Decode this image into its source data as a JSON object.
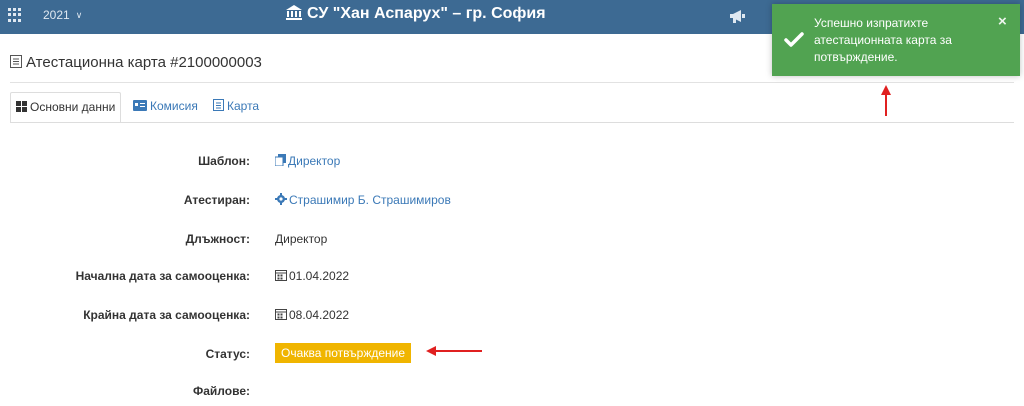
{
  "header": {
    "year": "2021",
    "school_name": "СУ \"Хан Аспарух\" – гр. София"
  },
  "page": {
    "title": "Атестационна карта #2100000003"
  },
  "tabs": [
    {
      "label": "Основни данни",
      "active": true
    },
    {
      "label": "Комисия",
      "active": false
    },
    {
      "label": "Карта",
      "active": false
    }
  ],
  "fields": {
    "template": {
      "label": "Шаблон:",
      "value": "Директор"
    },
    "attested": {
      "label": "Атестиран:",
      "value": "Страшимир Б. Страшимиров"
    },
    "position": {
      "label": "Длъжност:",
      "value": "Директор"
    },
    "start_date": {
      "label": "Начална дата за самооценка:",
      "value": "01.04.2022"
    },
    "end_date": {
      "label": "Крайна дата за самооценка:",
      "value": "08.04.2022"
    },
    "status": {
      "label": "Статус:",
      "value": "Очаква потвърждение"
    },
    "files": {
      "label": "Файлове:"
    }
  },
  "toast": {
    "message": "Успешно изпратихте атестационната карта за потвърждение.",
    "close": "×"
  },
  "colors": {
    "header_bg": "#3d6a93",
    "link": "#3b79b7",
    "status_badge": "#f0b500",
    "toast_bg": "#51a351",
    "annotation_arrow": "#e02020"
  }
}
